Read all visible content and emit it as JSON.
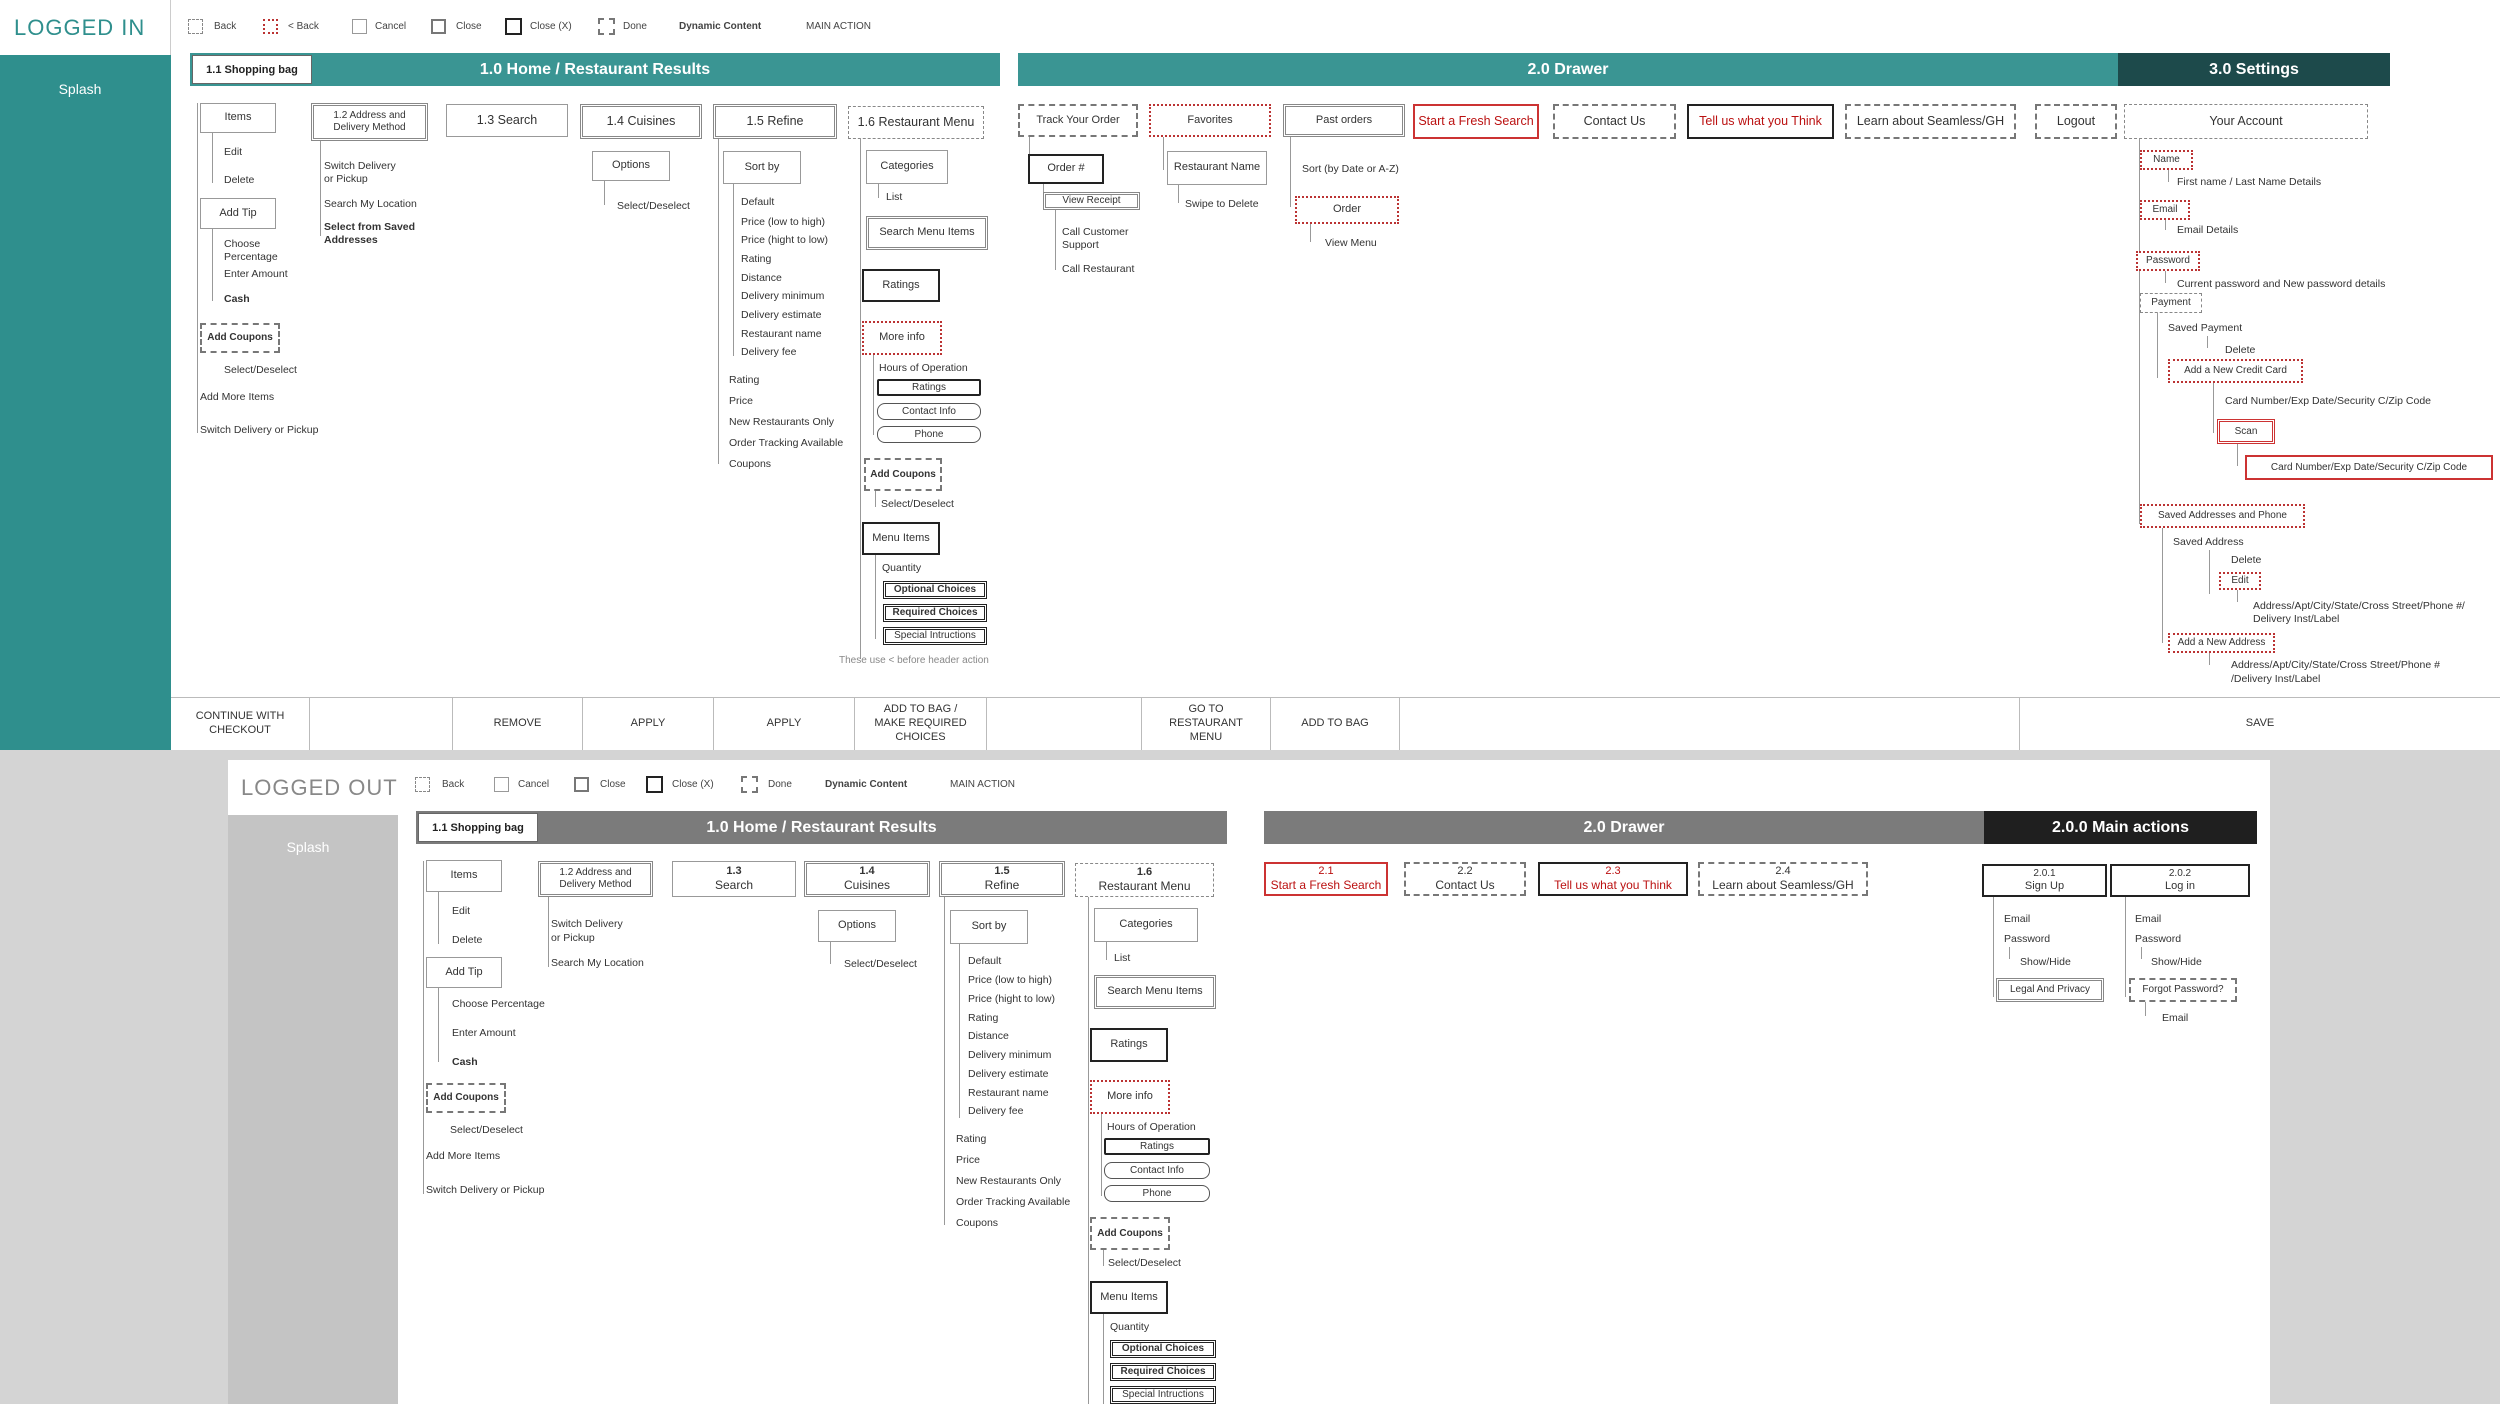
{
  "logged_in": {
    "title": "LOGGED IN",
    "splash": "Splash",
    "legend": [
      {
        "label": "Back",
        "style": "dash"
      },
      {
        "label": "< Back",
        "style": "reddot"
      },
      {
        "label": "Cancel",
        "style": "thin"
      },
      {
        "label": "Close",
        "style": "grey"
      },
      {
        "label": "Close (X)",
        "style": "bold"
      },
      {
        "label": "Done",
        "style": "bolddash"
      },
      {
        "label": "Dynamic Content",
        "style": "text-bold"
      },
      {
        "label": "MAIN ACTION",
        "style": "text"
      }
    ],
    "shopping_bag": "1.1 Shopping bag",
    "home_header": "1.0 Home / Restaurant Results",
    "drawer_header": "2.0 Drawer",
    "settings_header": "3.0 Settings",
    "sections": {
      "items": "Items",
      "address": "1.2 Address and Delivery Method",
      "search": "1.3 Search",
      "cuisines": "1.4 Cuisines",
      "refine": "1.5 Refine",
      "restaurant_menu": "1.6 Restaurant Menu",
      "track_order": "Track Your Order",
      "favorites": "Favorites",
      "past_orders": "Past orders",
      "fresh_search": "Start a Fresh Search",
      "contact_us": "Contact Us",
      "tell_us": "Tell us what you Think",
      "learn": "Learn about Seamless/GH",
      "logout": "Logout",
      "your_account": "Your Account"
    },
    "bag_col": {
      "edit": "Edit",
      "delete": "Delete",
      "add_tip": "Add Tip",
      "choose_pct": "Choose",
      "choose_pct2": "Percentage",
      "enter_amount": "Enter Amount",
      "cash": "Cash",
      "add_coupons": "Add Coupons",
      "select_deselect": "Select/Deselect",
      "add_more": "Add More Items",
      "switch": "Switch Delivery or Pickup"
    },
    "address_col": {
      "switch1": "Switch Delivery",
      "switch2": "or Pickup",
      "search_loc": "Search My Location",
      "saved1": "Select from Saved",
      "saved2": "Addresses"
    },
    "cuisines_col": {
      "options": "Options",
      "select": "Select/Deselect"
    },
    "refine_col": {
      "sort_by": "Sort by",
      "sorts": [
        "Default",
        "Price (low to high)",
        "Price (hight to low)",
        "Rating",
        "Distance",
        "Delivery minimum",
        "Delivery estimate",
        "Restaurant name",
        "Delivery fee"
      ],
      "filters": [
        "Rating",
        "Price",
        "New Restaurants Only",
        "Order Tracking Available",
        "Coupons"
      ]
    },
    "menu_col": {
      "categories": "Categories",
      "list": "List",
      "search_items": "Search Menu Items",
      "ratings": "Ratings",
      "more_info": "More info",
      "hours": "Hours of Operation",
      "ratings_pill": "Ratings",
      "contact_pill": "Contact Info",
      "phone_pill": "Phone",
      "add_coupons": "Add Coupons",
      "select": "Select/Deselect",
      "menu_items": "Menu Items",
      "quantity": "Quantity",
      "optional": "Optional Choices",
      "required": "Required Choices",
      "special": "Special Intructions",
      "note": "These use < before header action"
    },
    "track_col": {
      "order_num": "Order #",
      "view_receipt": "View Receipt",
      "call_cs1": "Call Customer",
      "call_cs2": "Support",
      "call_rest": "Call Restaurant"
    },
    "fav_col": {
      "restaurant_name": "Restaurant Name",
      "swipe": "Swipe to Delete"
    },
    "past_col": {
      "sort": "Sort (by Date or A-Z)",
      "order": "Order",
      "view_menu": "View Menu"
    },
    "account_col": {
      "name": "Name",
      "name_detail": "First name / Last Name Details",
      "email": "Email",
      "email_detail": "Email Details",
      "password": "Password",
      "password_detail": "Current password and New password details",
      "payment": "Payment",
      "saved_payment": "Saved Payment",
      "delete": "Delete",
      "add_card": "Add a New Credit Card",
      "card_details": "Card Number/Exp Date/Security C/Zip Code",
      "scan": "Scan",
      "scan_details": "Card Number/Exp Date/Security C/Zip Code",
      "saved_addresses": "Saved Addresses and Phone",
      "saved_address": "Saved Address",
      "addr_delete": "Delete",
      "addr_edit": "Edit",
      "addr_detail1": "Address/Apt/City/State/Cross Street/Phone #/",
      "addr_detail2": "Delivery Inst/Label",
      "add_address": "Add a New Address",
      "new_addr1": "Address/Apt/City/State/Cross Street/Phone #",
      "new_addr2": "/Delivery Inst/Label"
    },
    "actions": [
      "CONTINUE WITH\nCHECKOUT",
      "",
      "REMOVE",
      "APPLY",
      "APPLY",
      "ADD TO BAG /\nMAKE REQUIRED\nCHOICES",
      "",
      "GO TO\nRESTAURANT\nMENU",
      "ADD TO BAG",
      "",
      "SAVE"
    ]
  },
  "logged_out": {
    "title": "LOGGED OUT",
    "splash": "Splash",
    "legend": [
      {
        "label": "Back",
        "style": "dash"
      },
      {
        "label": "Cancel",
        "style": "thin"
      },
      {
        "label": "Close",
        "style": "grey"
      },
      {
        "label": "Close (X)",
        "style": "bold"
      },
      {
        "label": "Done",
        "style": "bolddash"
      },
      {
        "label": "Dynamic Content",
        "style": "text-bold"
      },
      {
        "label": "MAIN ACTION",
        "style": "text"
      }
    ],
    "shopping_bag": "1.1 Shopping bag",
    "home_header": "1.0 Home / Restaurant Results",
    "drawer_header": "2.0 Drawer",
    "main_actions_header": "2.0.0 Main actions",
    "sections": {
      "items": "Items",
      "address": "1.2 Address and Delivery Method",
      "search_num": "1.3",
      "search": "Search",
      "cuisines_num": "1.4",
      "cuisines": "Cuisines",
      "refine_num": "1.5",
      "refine": "Refine",
      "menu_num": "1.6",
      "menu": "Restaurant Menu",
      "fresh_num": "2.1",
      "fresh": "Start a Fresh Search",
      "contact_num": "2.2",
      "contact": "Contact Us",
      "tell_num": "2.3",
      "tell": "Tell us what you Think",
      "learn_num": "2.4",
      "learn": "Learn about Seamless/GH",
      "signup_num": "2.0.1",
      "signup": "Sign Up",
      "login_num": "2.0.2",
      "login": "Log in"
    },
    "bag_col": {
      "edit": "Edit",
      "delete": "Delete",
      "add_tip": "Add Tip",
      "choose_pct": "Choose Percentage",
      "enter_amount": "Enter Amount",
      "cash": "Cash",
      "add_coupons": "Add Coupons",
      "select_deselect": "Select/Deselect",
      "add_more": "Add More Items",
      "switch": "Switch Delivery or Pickup"
    },
    "address_col": {
      "switch1": "Switch Delivery",
      "switch2": "or Pickup",
      "search_loc": "Search My Location"
    },
    "cuisines_col": {
      "options": "Options",
      "select": "Select/Deselect"
    },
    "refine_col": {
      "sort_by": "Sort by",
      "sorts": [
        "Default",
        "Price (low to high)",
        "Price (hight to low)",
        "Rating",
        "Distance",
        "Delivery minimum",
        "Delivery estimate",
        "Restaurant name",
        "Delivery fee"
      ],
      "filters": [
        "Rating",
        "Price",
        "New Restaurants Only",
        "Order Tracking Available",
        "Coupons"
      ]
    },
    "menu_col": {
      "categories": "Categories",
      "list": "List",
      "search_items": "Search Menu Items",
      "ratings": "Ratings",
      "more_info": "More info",
      "hours": "Hours of Operation",
      "ratings_pill": "Ratings",
      "contact_pill": "Contact Info",
      "phone_pill": "Phone",
      "add_coupons": "Add Coupons",
      "select": "Select/Deselect",
      "menu_items": "Menu Items",
      "quantity": "Quantity",
      "optional": "Optional Choices",
      "required": "Required Choices",
      "special": "Special Intructions"
    },
    "signup_col": {
      "email": "Email",
      "password": "Password",
      "show_hide": "Show/Hide",
      "legal": "Legal And Privacy"
    },
    "login_col": {
      "email": "Email",
      "password": "Password",
      "show_hide": "Show/Hide",
      "forgot": "Forgot Password?",
      "forgot_email": "Email"
    }
  }
}
